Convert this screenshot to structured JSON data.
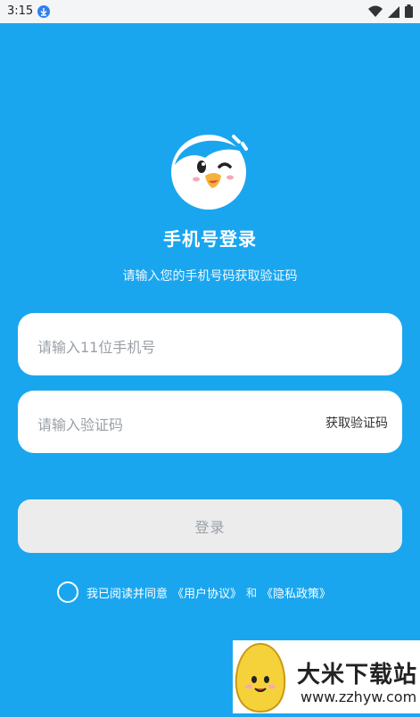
{
  "status_bar": {
    "time": "3:15",
    "icons": [
      "download-icon",
      "wifi-icon",
      "cell-signal-icon",
      "battery-icon"
    ]
  },
  "header": {
    "title": "手机号登录",
    "subtitle": "请输入您的手机号码获取验证码"
  },
  "form": {
    "phone_placeholder": "请输入11位手机号",
    "code_placeholder": "请输入验证码",
    "get_code_label": "获取验证码",
    "login_label": "登录"
  },
  "agreement": {
    "text": "我已阅读并同意",
    "user_agreement": "《用户协议》",
    "and": "和",
    "privacy_policy": "《隐私政策》",
    "checked": false
  },
  "watermark": {
    "name": "大米下载站",
    "url": "www.zzhyw.com"
  },
  "colors": {
    "background": "#1aa6ef",
    "field": "#ffffff",
    "button_disabled": "#ececec",
    "text_on_bg": "#ffffff"
  }
}
